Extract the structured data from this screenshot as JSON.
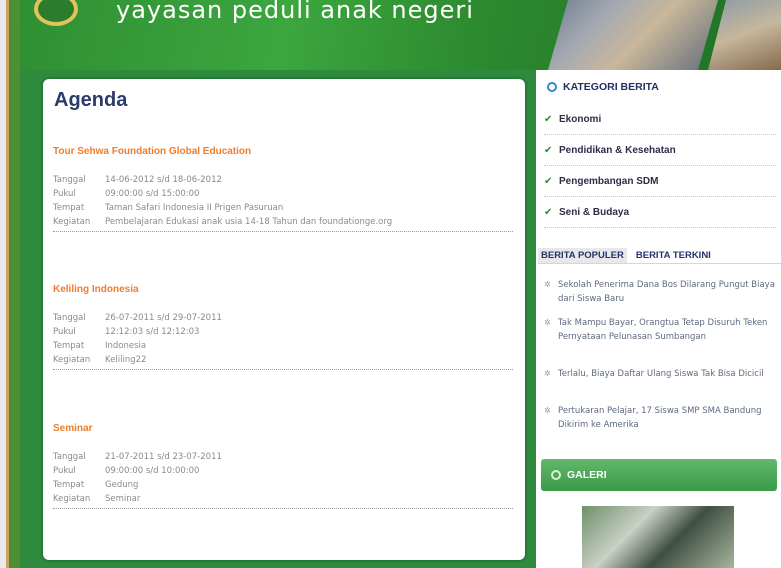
{
  "header": {
    "site_title": "yayasan peduli anak negeri"
  },
  "main": {
    "page_title": "Agenda",
    "events": [
      {
        "title": "Tour Sehwa Foundation Global Education",
        "details": [
          {
            "label": "Tanggal",
            "value": "14-06-2012 s/d 18-06-2012"
          },
          {
            "label": "Pukul",
            "value": "09:00:00 s/d 15:00:00"
          },
          {
            "label": "Tempat",
            "value": "Taman Safari Indonesia II Prigen Pasuruan"
          },
          {
            "label": "Kegiatan",
            "value": "Pembelajaran Edukasi anak usia 14-18 Tahun dan foundationge.org"
          }
        ]
      },
      {
        "title": "Keliling Indonesia",
        "details": [
          {
            "label": "Tanggal",
            "value": "26-07-2011 s/d 29-07-2011"
          },
          {
            "label": "Pukul",
            "value": "12:12:03 s/d 12:12:03"
          },
          {
            "label": "Tempat",
            "value": "Indonesia"
          },
          {
            "label": "Kegiatan",
            "value": "Keliling22"
          }
        ]
      },
      {
        "title": "Seminar",
        "details": [
          {
            "label": "Tanggal",
            "value": "21-07-2011 s/d 23-07-2011"
          },
          {
            "label": "Pukul",
            "value": "09:00:00 s/d 10:00:00"
          },
          {
            "label": "Tempat",
            "value": "Gedung"
          },
          {
            "label": "Kegiatan",
            "value": "Seminar"
          }
        ]
      }
    ]
  },
  "sidebar": {
    "categories_title": "KATEGORI BERITA",
    "categories": [
      "Ekonomi",
      "Pendidikan & Kesehatan",
      "Pengembangan SDM",
      "Seni & Budaya"
    ],
    "tabs": [
      "BERITA POPULER",
      "BERITA TERKINI"
    ],
    "news": [
      "Sekolah Penerima Dana Bos Dilarang Pungut Biaya dari Siswa Baru",
      "Tak Mampu Bayar, Orangtua Tetap Disuruh Teken Pernyataan Pelunasan Sumbangan",
      "Terlalu, Biaya Daftar Ulang Siswa Tak Bisa Dicicil",
      "Pertukaran Pelajar, 17 Siswa SMP SMA Bandung Dikirim ke Amerika"
    ],
    "gallery_title": "GALERI"
  },
  "colors": {
    "header_green": "#3ca63f",
    "panel_green": "#2e8a3c",
    "title_navy": "#2b3b6b",
    "event_orange": "#ef7d2c"
  }
}
